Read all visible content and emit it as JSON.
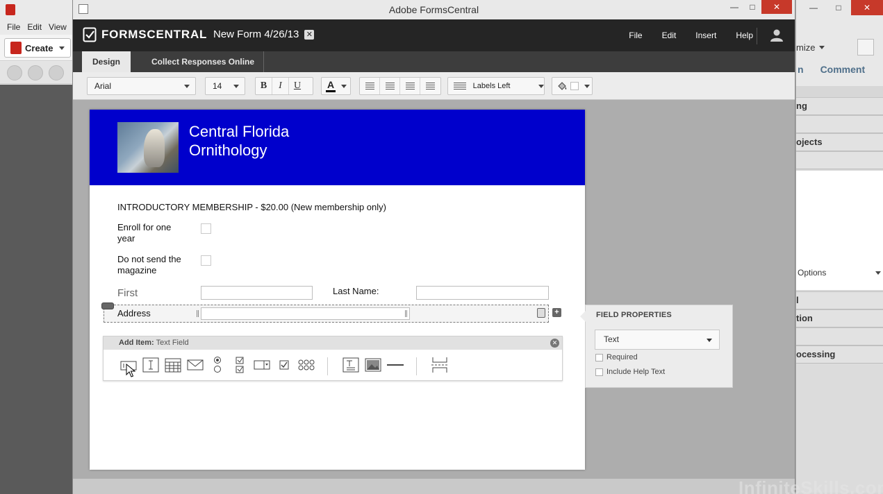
{
  "background_app": {
    "menu": [
      "File",
      "Edit",
      "View"
    ],
    "create_label": "Create",
    "right_tool_label": "mize",
    "right_tabs": [
      "n",
      "Comment"
    ],
    "right_rows": [
      "ng",
      "ojects",
      "",
      "l",
      "tion",
      "",
      "ocessing"
    ],
    "right_option": "Options"
  },
  "window": {
    "title": "Adobe FormsCentral",
    "minimize": "—",
    "maximize": "□",
    "close": "✕"
  },
  "appbar": {
    "logo_text": "FORMSCENTRAL",
    "form_name": "New Form 4/26/13",
    "form_close": "✕",
    "menu": [
      "File",
      "Edit",
      "Insert",
      "Help"
    ]
  },
  "tabs": {
    "design": "Design",
    "collect": "Collect Responses Online"
  },
  "formatbar": {
    "font": "Arial",
    "size": "14",
    "bold": "B",
    "italic": "I",
    "underline": "U",
    "text_color_glyph": "A",
    "labels_position": "Labels Left",
    "text_color": "#000000",
    "fill_color": "#ffffff"
  },
  "form": {
    "title_line1": "Central Florida",
    "title_line2": "Ornithology",
    "header_color": "#0000cc",
    "intro": "INTRODUCTORY MEMBERSHIP - $20.00 (New membership only)",
    "enroll_label_1": "Enroll for one",
    "enroll_label_2": "year",
    "magazine_label_1": "Do not send the",
    "magazine_label_2": "magazine",
    "first_label": "First",
    "last_name_label": "Last Name:",
    "address_label": "Address"
  },
  "add_item": {
    "prefix": "Add Item:",
    "type": "Text Field",
    "close": "✕"
  },
  "field_properties": {
    "title": "FIELD PROPERTIES",
    "type_value": "Text",
    "required": "Required",
    "include_help": "Include Help Text"
  },
  "watermark": "InfiniteSkills.com"
}
